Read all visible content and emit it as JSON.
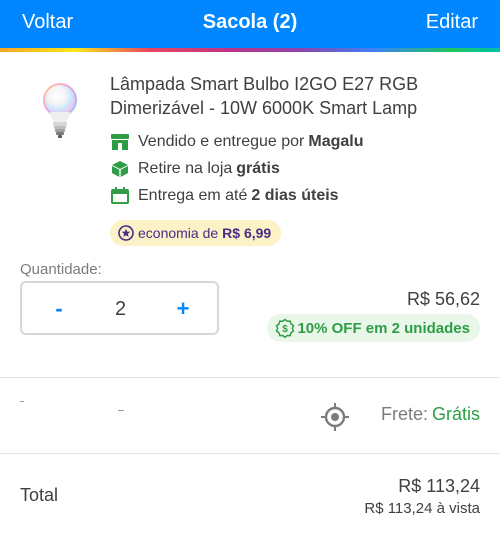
{
  "header": {
    "back_label": "Voltar",
    "title": "Sacola (2)",
    "edit_label": "Editar",
    "bg_color": "#0086ff"
  },
  "product": {
    "name": "Lâmpada Smart Bulbo I2GO E27 RGB Dimerizável - 10W 6000K Smart Lamp",
    "image_icon": "smart-bulb",
    "seller_prefix": "Vendido e entregue por",
    "seller_name": "Magalu",
    "pickup_prefix": "Retire na loja",
    "pickup_value": "grátis",
    "delivery_prefix": "Entrega em até",
    "delivery_value": "2 dias úteis",
    "economy_prefix": "economia de",
    "economy_value": "R$ 6,99"
  },
  "quantity": {
    "label": "Quantidade:",
    "minus": "-",
    "value": "2",
    "plus": "+"
  },
  "pricing": {
    "unit_price": "R$ 56,62",
    "discount": "10% OFF em 2 unidades"
  },
  "shipping": {
    "label": "Frete:",
    "value": "Grátis"
  },
  "total": {
    "label": "Total",
    "value": "R$ 113,24",
    "cash": "R$ 113,24 à vista"
  },
  "colors": {
    "accent": "#0086ff",
    "green": "#2e9d45",
    "purple": "#4b2c86",
    "economy_bg": "#fdf1c7",
    "discount_bg": "#e8f7ea"
  }
}
